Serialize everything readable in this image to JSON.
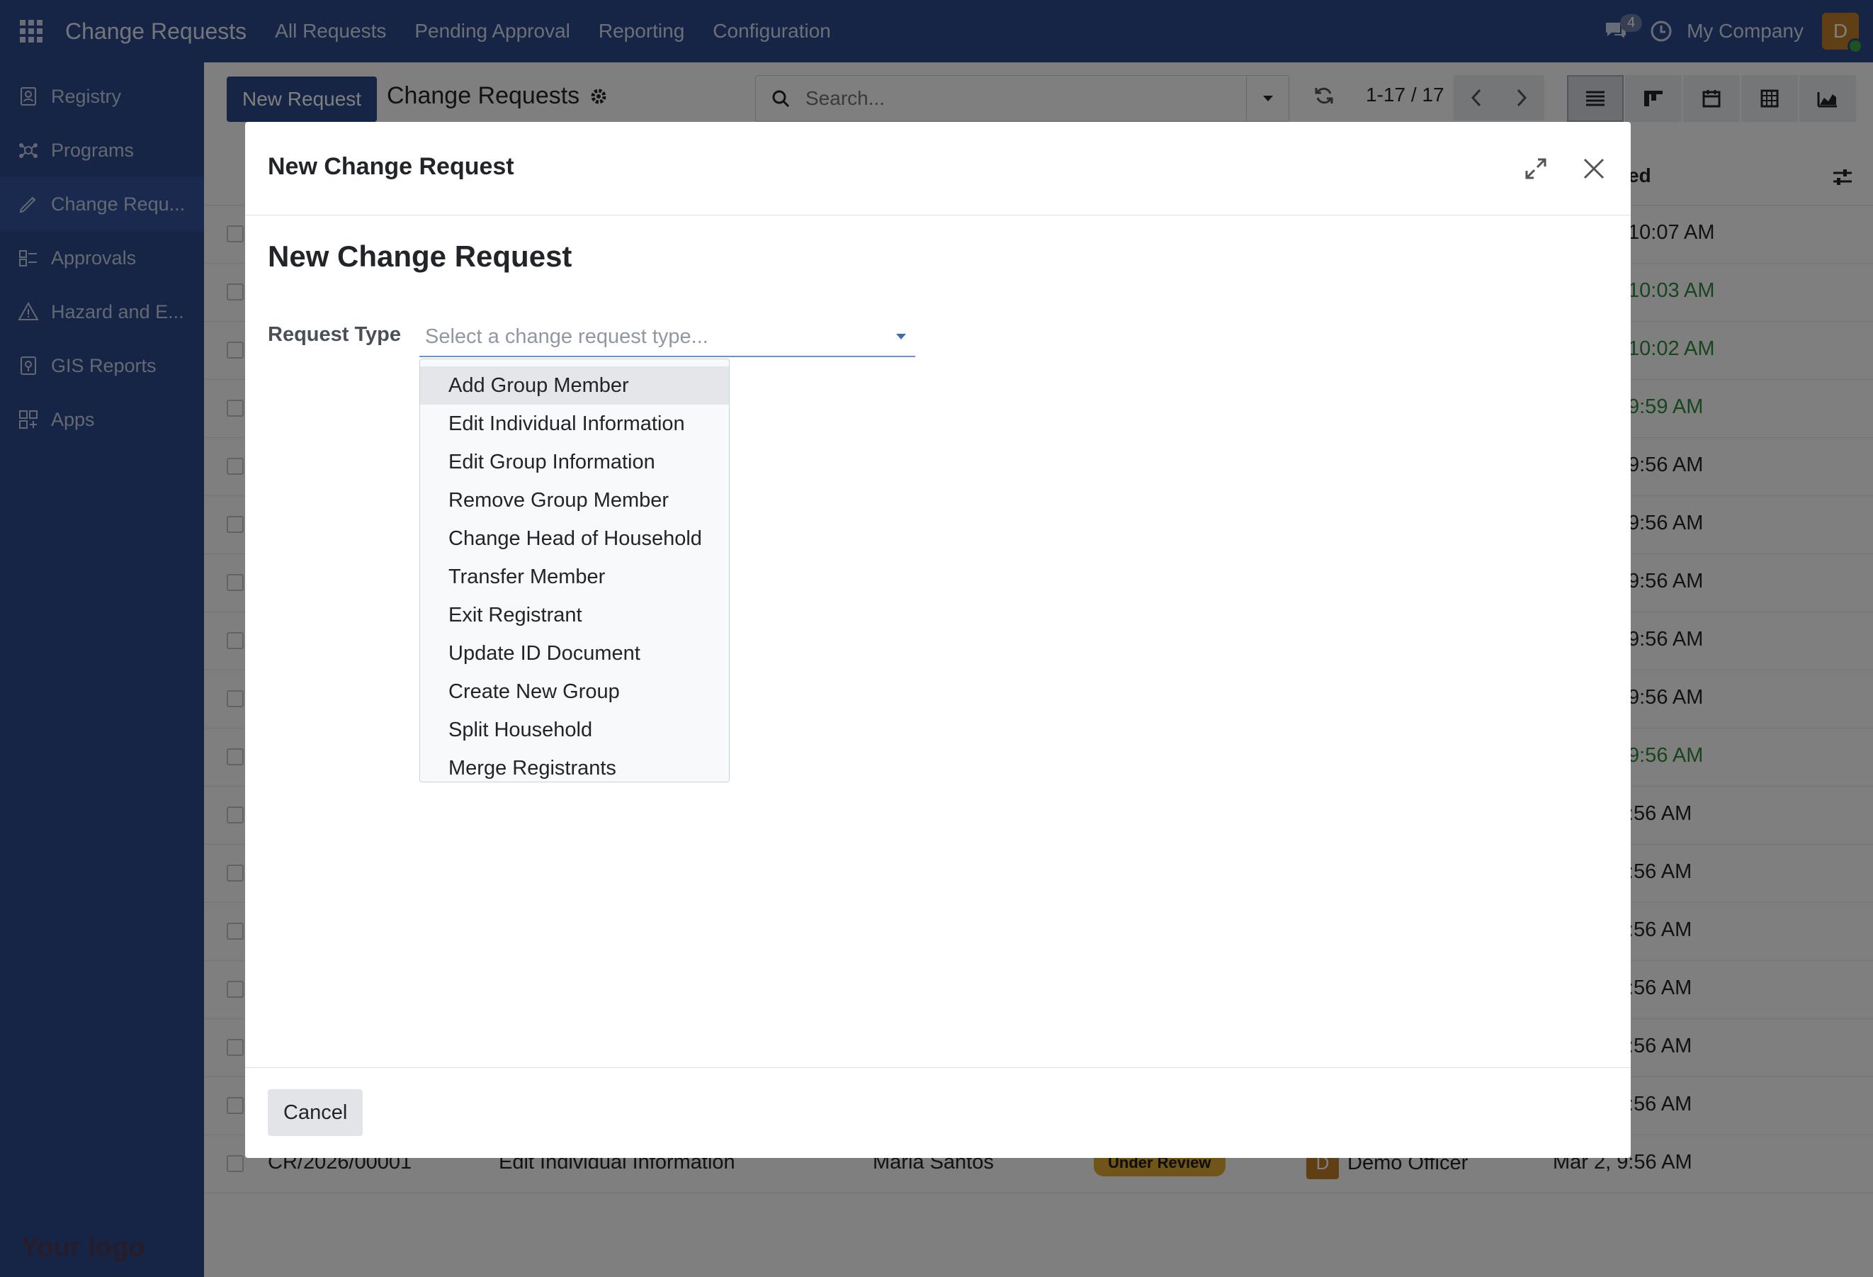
{
  "navbar": {
    "brand": "Change Requests",
    "menu": [
      "All Requests",
      "Pending Approval",
      "Reporting",
      "Configuration"
    ],
    "chat_count": "4",
    "company": "My Company",
    "avatar_initial": "D"
  },
  "sidebar": {
    "items": [
      {
        "label": "Registry",
        "icon": "registry-icon"
      },
      {
        "label": "Programs",
        "icon": "programs-icon"
      },
      {
        "label": "Change Requ...",
        "icon": "change-request-icon"
      },
      {
        "label": "Approvals",
        "icon": "approvals-icon"
      },
      {
        "label": "Hazard and E...",
        "icon": "hazard-icon"
      },
      {
        "label": "GIS Reports",
        "icon": "gis-icon"
      },
      {
        "label": "Apps",
        "icon": "apps-icon"
      }
    ],
    "logo": "Your logo"
  },
  "control": {
    "new_button": "New Request",
    "title": "Change Requests",
    "search_placeholder": "Search...",
    "pager": "1-17 / 17"
  },
  "list": {
    "last_col_header": "ed",
    "times": [
      {
        "text": "10:07 AM",
        "green": false
      },
      {
        "text": "10:03 AM",
        "green": true
      },
      {
        "text": "10:02 AM",
        "green": true
      },
      {
        "text": "9:59 AM",
        "green": true
      },
      {
        "text": "9:56 AM",
        "green": false
      },
      {
        "text": "9:56 AM",
        "green": false
      },
      {
        "text": "9:56 AM",
        "green": false
      },
      {
        "text": "9:56 AM",
        "green": false
      },
      {
        "text": "9:56 AM",
        "green": false
      },
      {
        "text": "9:56 AM",
        "green": true
      },
      {
        "text": ":56 AM",
        "green": false
      },
      {
        "text": ":56 AM",
        "green": false
      },
      {
        "text": ":56 AM",
        "green": false
      },
      {
        "text": ":56 AM",
        "green": false
      },
      {
        "text": ":56 AM",
        "green": false
      },
      {
        "text": ":56 AM",
        "green": false
      }
    ],
    "last_row": {
      "ref": "CR/2026/00001",
      "type": "Edit Individual Information",
      "registrant": "Maria Santos",
      "status": "Under Review",
      "officer_initial": "D",
      "officer": "Demo Officer",
      "date": "Mar 2, 9:56 AM"
    }
  },
  "modal": {
    "header_title": "New Change Request",
    "form_heading": "New Change Request",
    "field_label": "Request Type",
    "select_placeholder": "Select a change request type...",
    "options": [
      "Add Group Member",
      "Edit Individual Information",
      "Edit Group Information",
      "Remove Group Member",
      "Change Head of Household",
      "Transfer Member",
      "Exit Registrant",
      "Update ID Document",
      "Create New Group",
      "Split Household",
      "Merge Registrants"
    ],
    "cancel_label": "Cancel"
  },
  "colors": {
    "navbar": "#2d4a8a",
    "primary_button": "#2d4a8a",
    "status_badge": "#e0a830",
    "time_green": "#2e8b3a"
  }
}
